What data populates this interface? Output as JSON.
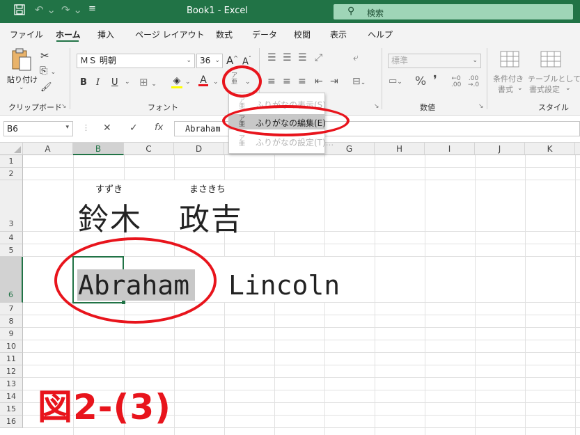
{
  "titlebar": {
    "title": "Book1  -  Excel",
    "search": "検索",
    "save_icon": "save-icon",
    "undo_icon": "undo-icon",
    "redo_icon": "redo-icon"
  },
  "tabs": [
    "ファイル",
    "ホーム",
    "挿入",
    "ページ レイアウト",
    "数式",
    "データ",
    "校閲",
    "表示",
    "ヘルプ"
  ],
  "active_tab": "ホーム",
  "ribbon": {
    "clipboard": {
      "paste": "貼り付け",
      "label": "クリップボード"
    },
    "font": {
      "name": "ＭＳ 明朝",
      "size": "36",
      "bold": "B",
      "italic": "I",
      "underline": "U",
      "grow": "A",
      "shrink": "A",
      "label": "フォント"
    },
    "number": {
      "format": "標準",
      "percent": "%",
      "comma": "❜",
      "label": "数値"
    },
    "style": {
      "conditional": "条件付き",
      "conditional2": "書式",
      "table": "テーブルとして",
      "table2": "書式設定",
      "label": "スタイル"
    }
  },
  "phonetic_menu": {
    "items": [
      {
        "label": "ふりがなの表示(S)",
        "enabled": false
      },
      {
        "label": "ふりがなの編集(E)",
        "enabled": true,
        "highlighted": true
      },
      {
        "label": "ふりがなの設定(T)...",
        "enabled": false
      }
    ]
  },
  "formula_bar": {
    "name_box": "B6",
    "cancel": "✕",
    "enter": "✓",
    "fx": "fx",
    "content": "Abraham"
  },
  "columns": [
    "A",
    "B",
    "C",
    "D",
    "E",
    "F",
    "G",
    "H",
    "I",
    "J",
    "K"
  ],
  "selected_column": "B",
  "rows": [
    "1",
    "2",
    "3",
    "4",
    "5",
    "6",
    "7",
    "8",
    "9",
    "10",
    "11",
    "12",
    "13",
    "14",
    "15",
    "16"
  ],
  "selected_row": "6",
  "cells": {
    "b3_furigana": "すずき",
    "b3_text": "鈴木",
    "d3_furigana": "まさきち",
    "d3_text": "政吉",
    "b6_text": "Abraham",
    "d6_text": "Lincoln"
  },
  "figure_label": "図2-(3)",
  "colors": {
    "excel_green": "#217346",
    "annotation_red": "#e8141c"
  }
}
